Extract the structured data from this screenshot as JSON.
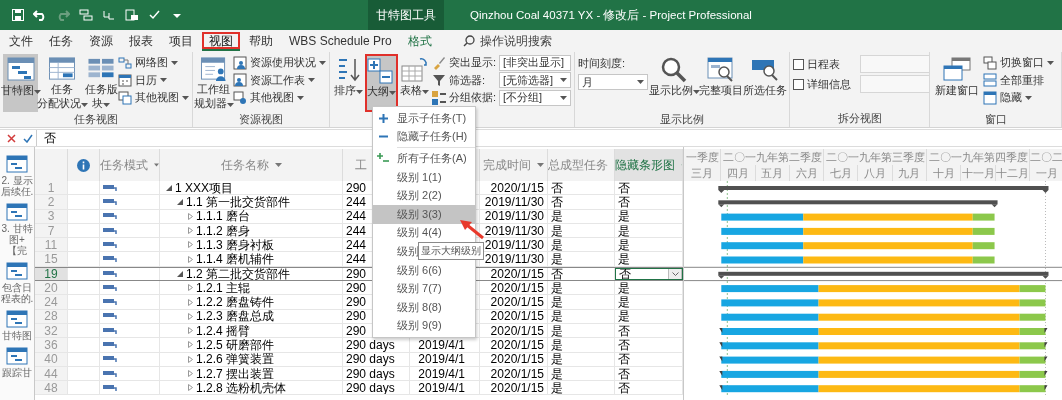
{
  "title_bar": {
    "context_tab": "甘特图工具",
    "title": "Qinzhou Coal 40371 YX - 修改后 - Project Professional"
  },
  "tabs": [
    {
      "label": "文件",
      "selected": false,
      "contextual": false,
      "marked": false
    },
    {
      "label": "任务",
      "selected": false,
      "contextual": false,
      "marked": false
    },
    {
      "label": "资源",
      "selected": false,
      "contextual": false,
      "marked": false
    },
    {
      "label": "报表",
      "selected": false,
      "contextual": false,
      "marked": false
    },
    {
      "label": "项目",
      "selected": false,
      "contextual": false,
      "marked": false
    },
    {
      "label": "视图",
      "selected": true,
      "contextual": false,
      "marked": true
    },
    {
      "label": "帮助",
      "selected": false,
      "contextual": false,
      "marked": false
    },
    {
      "label": "WBS Schedule Pro",
      "selected": false,
      "contextual": false,
      "marked": false
    },
    {
      "label": "格式",
      "selected": false,
      "contextual": true,
      "marked": false
    }
  ],
  "search": {
    "placeholder": "操作说明搜索"
  },
  "ribbon": [
    {
      "label": "任务视图",
      "items": [
        {
          "kind": "large",
          "lines": [
            "甘特图"
          ],
          "dropdown": true,
          "pressed": true,
          "marked": false
        },
        {
          "kind": "large",
          "lines": [
            "任务",
            "分配状况"
          ],
          "dropdown": true,
          "pressed": false,
          "marked": false
        },
        {
          "kind": "large",
          "lines": [
            "任务版",
            "块"
          ],
          "dropdown": true,
          "pressed": false,
          "marked": false
        },
        {
          "kind": "small",
          "label": "网络图",
          "dropdown": true
        },
        {
          "kind": "small",
          "label": "日历",
          "dropdown": true
        },
        {
          "kind": "small",
          "label": "其他视图",
          "dropdown": true
        }
      ]
    },
    {
      "label": "资源视图",
      "items": [
        {
          "kind": "large",
          "lines": [
            "工作组",
            "规划器"
          ],
          "dropdown": true,
          "pressed": false,
          "marked": false
        },
        {
          "kind": "small",
          "label": "资源使用状况",
          "dropdown": true
        },
        {
          "kind": "small",
          "label": "资源工作表",
          "dropdown": true
        },
        {
          "kind": "small",
          "label": "其他视图",
          "dropdown": true
        }
      ]
    },
    {
      "items": [
        {
          "kind": "large",
          "lines": [
            "排序"
          ],
          "dropdown": true,
          "pressed": false,
          "marked": false
        },
        {
          "kind": "large",
          "lines": [
            "大纲"
          ],
          "dropdown": true,
          "pressed": true,
          "marked": true
        },
        {
          "kind": "large",
          "lines": [
            "表格"
          ],
          "dropdown": true,
          "pressed": false,
          "marked": false
        },
        {
          "kind": "field",
          "label": "突出显示:",
          "value": "[非突出显示]"
        },
        {
          "kind": "field",
          "label": "筛选器:",
          "value": "[无筛选器]"
        },
        {
          "kind": "field",
          "label": "分组依据:",
          "value": "[不分组]"
        }
      ]
    },
    {
      "label": "显示比例",
      "items": [
        {
          "kind": "scale",
          "label": "时间刻度:",
          "value": "月"
        },
        {
          "kind": "large",
          "lines": [
            "显示比例"
          ],
          "dropdown": true,
          "pressed": false,
          "marked": false
        },
        {
          "kind": "large",
          "lines": [
            "完整项目"
          ],
          "dropdown": false,
          "pressed": false,
          "marked": false
        },
        {
          "kind": "large",
          "lines": [
            "所选任务"
          ],
          "dropdown": false,
          "pressed": false,
          "marked": false
        }
      ]
    },
    {
      "label": "拆分视图",
      "items": [
        {
          "kind": "check",
          "label": "日程表",
          "checked": false
        },
        {
          "kind": "check",
          "label": "详细信息",
          "checked": false
        }
      ]
    },
    {
      "label": "窗口",
      "items": [
        {
          "kind": "large",
          "lines": [
            "新建窗口"
          ],
          "dropdown": false,
          "pressed": false,
          "marked": false
        },
        {
          "kind": "small",
          "label": "切换窗口",
          "dropdown": true
        },
        {
          "kind": "small",
          "label": "全部重排",
          "dropdown": false
        },
        {
          "kind": "small",
          "label": "隐藏",
          "dropdown": true
        }
      ]
    }
  ],
  "formula_bar": {
    "value": "否"
  },
  "view_bar": [
    {
      "label": "2. 显示后续任."
    },
    {
      "label": "3. 甘特图+【完"
    },
    {
      "label": "包含日程表的."
    },
    {
      "label": "甘特图"
    },
    {
      "label": "跟踪甘"
    }
  ],
  "table": {
    "columns": [
      {
        "kind": "indicators",
        "selected": false
      },
      {
        "kind": "mode",
        "label": "任务模式",
        "selected": false,
        "filter": true
      },
      {
        "kind": "name",
        "label": "任务名称",
        "selected": false,
        "filter": true
      },
      {
        "kind": "duration",
        "label": "工",
        "selected": false
      },
      {
        "kind": "start",
        "selected": false
      },
      {
        "kind": "finish",
        "label": "完成时间",
        "selected": false,
        "filter": true
      },
      {
        "kind": "summary",
        "label": "总成型任务",
        "selected": false,
        "filter": true
      },
      {
        "kind": "hide_bar",
        "label": "隐藏条形图",
        "selected": true,
        "filter": true
      }
    ],
    "rows": [
      {
        "id": "1",
        "name": "1 XXX项目",
        "duration": "290",
        "finish": "2020/1/15",
        "summary": "否",
        "hide_bar": "否",
        "kind": "summary",
        "expanded": true,
        "selected": false,
        "children": [
          {
            "id": "2",
            "name": "1.1 第一批交货部件",
            "duration": "244",
            "finish": "2019/11/30",
            "summary": "否",
            "hide_bar": "否",
            "kind": "summary",
            "expanded": true,
            "selected": false,
            "children": [
              {
                "id": "3",
                "name": "1.1.1 磨台",
                "duration": "244",
                "finish": "2019/11/30",
                "summary": "是",
                "hide_bar": "是",
                "kind": "task",
                "expanded": false,
                "selected": false
              },
              {
                "id": "7",
                "name": "1.1.2 磨身",
                "duration": "244",
                "finish": "2019/11/30",
                "summary": "是",
                "hide_bar": "是",
                "kind": "task",
                "expanded": false,
                "selected": false
              },
              {
                "id": "11",
                "name": "1.1.3 磨身衬板",
                "duration": "244",
                "finish": "2019/11/30",
                "summary": "是",
                "hide_bar": "是",
                "kind": "task",
                "expanded": false,
                "selected": false
              },
              {
                "id": "15",
                "name": "1.1.4 磨机辅件",
                "duration": "244",
                "finish": "2019/11/30",
                "summary": "是",
                "hide_bar": "是",
                "kind": "task",
                "expanded": false,
                "selected": false
              }
            ]
          },
          {
            "id": "19",
            "name": "1.2 第二批交货部件",
            "duration": "290",
            "finish": "2020/1/15",
            "summary": "否",
            "hide_bar": "否",
            "kind": "summary",
            "expanded": true,
            "selected": true,
            "children": [
              {
                "id": "20",
                "name": "1.2.1 主辊",
                "duration": "290",
                "finish": "2020/1/15",
                "summary": "是",
                "hide_bar": "是",
                "kind": "task",
                "expanded": false,
                "selected": false
              },
              {
                "id": "24",
                "name": "1.2.2 磨盘铸件",
                "duration": "290",
                "finish": "2020/1/15",
                "summary": "是",
                "hide_bar": "是",
                "kind": "task",
                "expanded": false,
                "selected": false
              },
              {
                "id": "28",
                "name": "1.2.3 磨盘总成",
                "duration": "290",
                "finish": "2020/1/15",
                "summary": "是",
                "hide_bar": "是",
                "kind": "task",
                "expanded": false,
                "selected": false
              },
              {
                "id": "32",
                "name": "1.2.4 摇臂",
                "duration": "290",
                "finish": "2020/1/15",
                "summary": "是",
                "hide_bar": "否",
                "kind": "capped",
                "expanded": false,
                "selected": false
              },
              {
                "id": "36",
                "name": "1.2.5 研磨部件",
                "duration": "290 days",
                "start": "2019/4/1",
                "finish": "2020/1/15",
                "summary": "是",
                "hide_bar": "否",
                "kind": "capped",
                "expanded": false,
                "selected": false
              },
              {
                "id": "40",
                "name": "1.2.6 弹簧装置",
                "duration": "290 days",
                "start": "2019/4/1",
                "finish": "2020/1/15",
                "summary": "是",
                "hide_bar": "否",
                "kind": "capped",
                "expanded": false,
                "selected": false
              },
              {
                "id": "44",
                "name": "1.2.7 摆出装置",
                "duration": "290 days",
                "start": "2019/4/1",
                "finish": "2020/1/15",
                "summary": "是",
                "hide_bar": "否",
                "kind": "capped",
                "expanded": false,
                "selected": false
              },
              {
                "id": "48",
                "name": "1.2.8 选粉机壳体",
                "duration": "290 days",
                "start": "2019/4/1",
                "finish": "2020/1/15",
                "summary": "是",
                "hide_bar": "否",
                "kind": "capped",
                "expanded": false,
                "selected": false
              }
            ]
          }
        ]
      }
    ]
  },
  "timescale": [
    {
      "label": "一季度",
      "months": [
        "三月"
      ]
    },
    {
      "label": "二〇一九年第二季度",
      "months": [
        "四月",
        "五月",
        "六月"
      ]
    },
    {
      "label": "二〇一九年第三季度",
      "months": [
        "七月",
        "八月",
        "九月"
      ]
    },
    {
      "label": "二〇一九年第四季度",
      "months": [
        "十月",
        "十一月",
        "十二月"
      ]
    },
    {
      "label": "二〇二",
      "months": [
        "一月"
      ]
    }
  ],
  "outline_menu": {
    "items": [
      {
        "kind": "show",
        "label": "显示子任务(T)",
        "selected": false
      },
      {
        "kind": "hide",
        "label": "隐藏子任务(H)",
        "selected": false
      },
      {
        "kind": "separator"
      },
      {
        "kind": "all",
        "label": "所有子任务(A)",
        "selected": false
      },
      {
        "kind": "level",
        "label": "级别 1(1)",
        "selected": false
      },
      {
        "kind": "level",
        "label": "级别 2(2)",
        "selected": false
      },
      {
        "kind": "level",
        "label": "级别 3(3)",
        "selected": true
      },
      {
        "kind": "level",
        "label": "级别 4(4)",
        "selected": false
      },
      {
        "kind": "level",
        "label": "级别",
        "selected": false
      },
      {
        "kind": "level",
        "label": "级别 6(6)",
        "selected": false
      },
      {
        "kind": "level",
        "label": "级别 7(7)",
        "selected": false
      },
      {
        "kind": "level",
        "label": "级别 8(8)",
        "selected": false
      },
      {
        "kind": "level",
        "label": "级别 9(9)",
        "selected": false
      }
    ]
  },
  "tooltip": {
    "text": "显示大纲级别"
  }
}
